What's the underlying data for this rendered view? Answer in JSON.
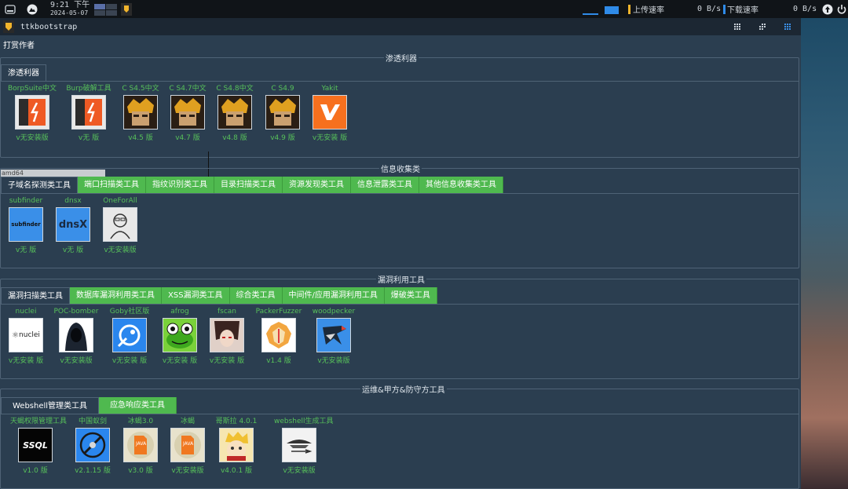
{
  "system_bar": {
    "time": "9:21 下午",
    "date": "2024-05-07",
    "upload_label": "上传速率",
    "upload_value": "0 B/s",
    "download_label": "下载速率",
    "download_value": "0 B/s"
  },
  "window": {
    "title": "ttkbootstrap",
    "menu_author": "打赏作者",
    "overlay_text": "amd64"
  },
  "sections": [
    {
      "title": "渗透利器",
      "tabs": [
        {
          "label": "渗透利器",
          "active": true
        }
      ],
      "tools": [
        {
          "name": "BorpSuite中文",
          "version": "v无安装版",
          "icon": "burp-icon"
        },
        {
          "name": "Burp破解工具",
          "version": "v无 版",
          "icon": "burp-icon"
        },
        {
          "name": "C S4.5中文",
          "version": "v4.5 版",
          "icon": "cobaltstrike-icon"
        },
        {
          "name": "C S4.7中文",
          "version": "v4.7 版",
          "icon": "cobaltstrike-icon"
        },
        {
          "name": "C S4.8中文",
          "version": "v4.8 版",
          "icon": "cobaltstrike-icon"
        },
        {
          "name": "C S4.9",
          "version": "v4.9 版",
          "icon": "cobaltstrike-icon"
        },
        {
          "name": "Yakit",
          "version": "v无安装 版",
          "icon": "yakit-icon"
        }
      ]
    },
    {
      "title": "信息收集类",
      "tabs": [
        {
          "label": "子域名探测类工具",
          "active": true
        },
        {
          "label": "端口扫描类工具",
          "active": false
        },
        {
          "label": "指纹识别类工具",
          "active": false
        },
        {
          "label": "目录扫描类工具",
          "active": false
        },
        {
          "label": "资源发现类工具",
          "active": false
        },
        {
          "label": "信息泄露类工具",
          "active": false
        },
        {
          "label": "其他信息收集类工具",
          "active": false
        }
      ],
      "tools": [
        {
          "name": "subfinder",
          "version": "v无 版",
          "icon": "subfinder-icon",
          "icon_text": "subfinder"
        },
        {
          "name": "dnsx",
          "version": "v无 版",
          "icon": "dnsx-icon",
          "icon_text": "dnsX"
        },
        {
          "name": "OneForAll",
          "version": "v无安装版",
          "icon": "oneforall-icon"
        }
      ]
    },
    {
      "title": "漏洞利用工具",
      "tabs": [
        {
          "label": "漏洞扫描类工具",
          "active": true
        },
        {
          "label": "数据库漏洞利用类工具",
          "active": false
        },
        {
          "label": "XSS漏洞类工具",
          "active": false
        },
        {
          "label": "综合类工具",
          "active": false
        },
        {
          "label": "中间件/应用漏洞利用工具",
          "active": false
        },
        {
          "label": "爆破类工具",
          "active": false
        }
      ],
      "tools": [
        {
          "name": "nuclei",
          "version": "v无安装 版",
          "icon": "nuclei-icon",
          "icon_text": "nuclei"
        },
        {
          "name": "POC-bomber",
          "version": "v无安装版",
          "icon": "hacker-hood-icon"
        },
        {
          "name": "Goby社区版",
          "version": "v无安装 版",
          "icon": "goby-icon"
        },
        {
          "name": "afrog",
          "version": "v无安装 版",
          "icon": "frog-icon"
        },
        {
          "name": "fscan",
          "version": "v无安装 版",
          "icon": "anime-avatar-icon"
        },
        {
          "name": "PackerFuzzer",
          "version": "v1.4 版",
          "icon": "lion-icon"
        },
        {
          "name": "woodpecker",
          "version": "v无安装版",
          "icon": "woodpecker-icon"
        }
      ]
    },
    {
      "title": "运维&甲方&防守方工具",
      "tabs": [
        {
          "label": "Webshell管理类工具",
          "active": true
        },
        {
          "label": "应急响应类工具",
          "active": false
        }
      ],
      "tools": [
        {
          "name": "天蝎权限管理工具",
          "version": "v1.0 版",
          "icon": "ssql-icon",
          "icon_text": "SSQL"
        },
        {
          "name": "中国蚁剑",
          "version": "v2.1.15 版",
          "icon": "antsword-icon"
        },
        {
          "name": "冰蝎3.0",
          "version": "v3.0 版",
          "icon": "java-icon",
          "icon_text": "JAVA"
        },
        {
          "name": "冰蝎",
          "version": "v无安装版",
          "icon": "java-icon",
          "icon_text": "JAVA"
        },
        {
          "name": "哥斯拉 4.0.1",
          "version": "v4.0.1 版",
          "icon": "godzilla-icon"
        },
        {
          "name": "webshell生成工具",
          "version": "v无安装版",
          "icon": "ship-icon"
        }
      ]
    }
  ]
}
